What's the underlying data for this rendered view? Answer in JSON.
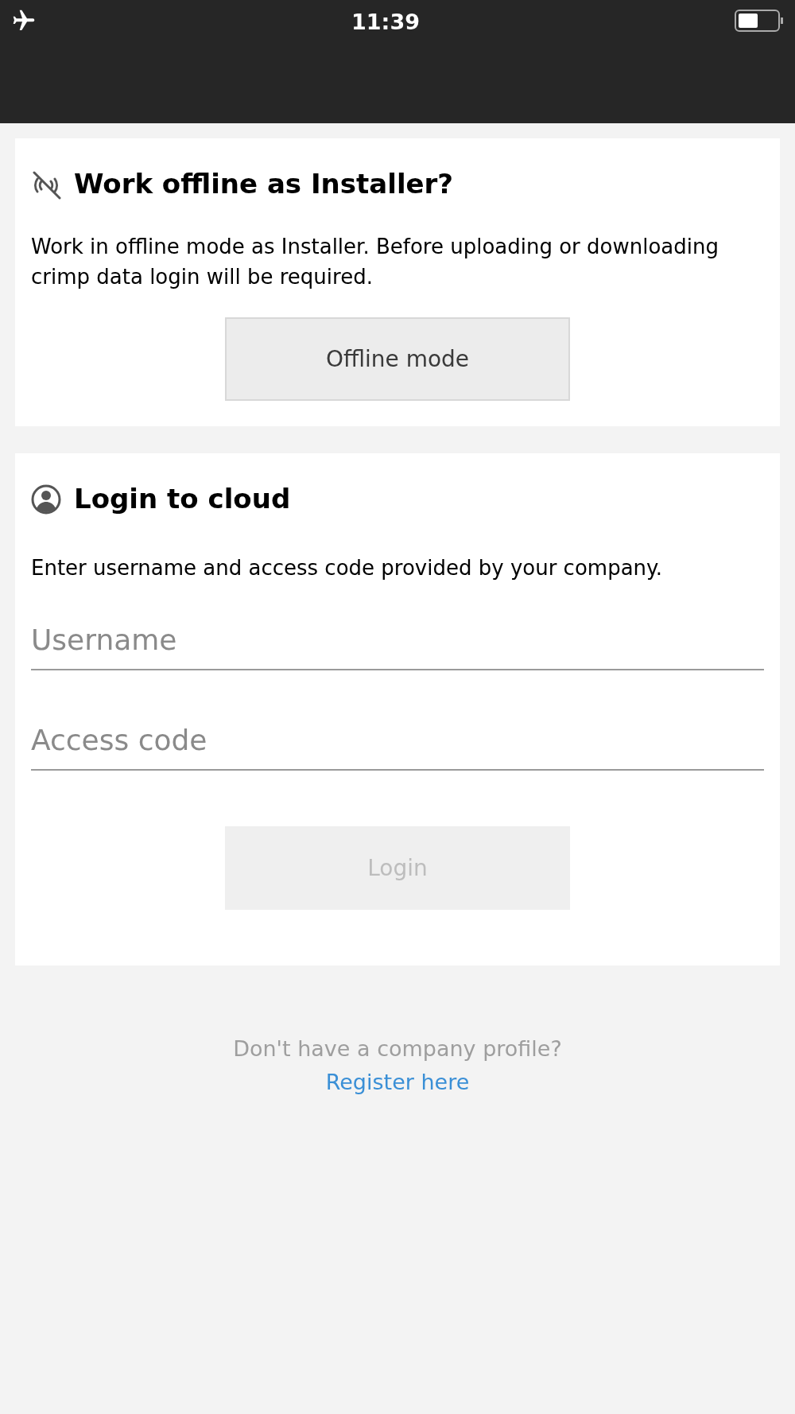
{
  "status_bar": {
    "time": "11:39"
  },
  "offline_card": {
    "title": "Work offline as Installer?",
    "text": "Work in offline mode as Installer. Before uploading or downloading crimp data login will be required.",
    "button": {
      "label": "Offline mode",
      "disabled": false
    }
  },
  "login_card": {
    "title": "Login to cloud",
    "text": "Enter username and access code provided by your company.",
    "fields": [
      {
        "placeholder": "Username"
      },
      {
        "placeholder": "Access code"
      }
    ],
    "button": {
      "label": "Login",
      "disabled": true
    }
  },
  "footer": {
    "text": "Don't have a company profile?",
    "link": "Register here"
  }
}
